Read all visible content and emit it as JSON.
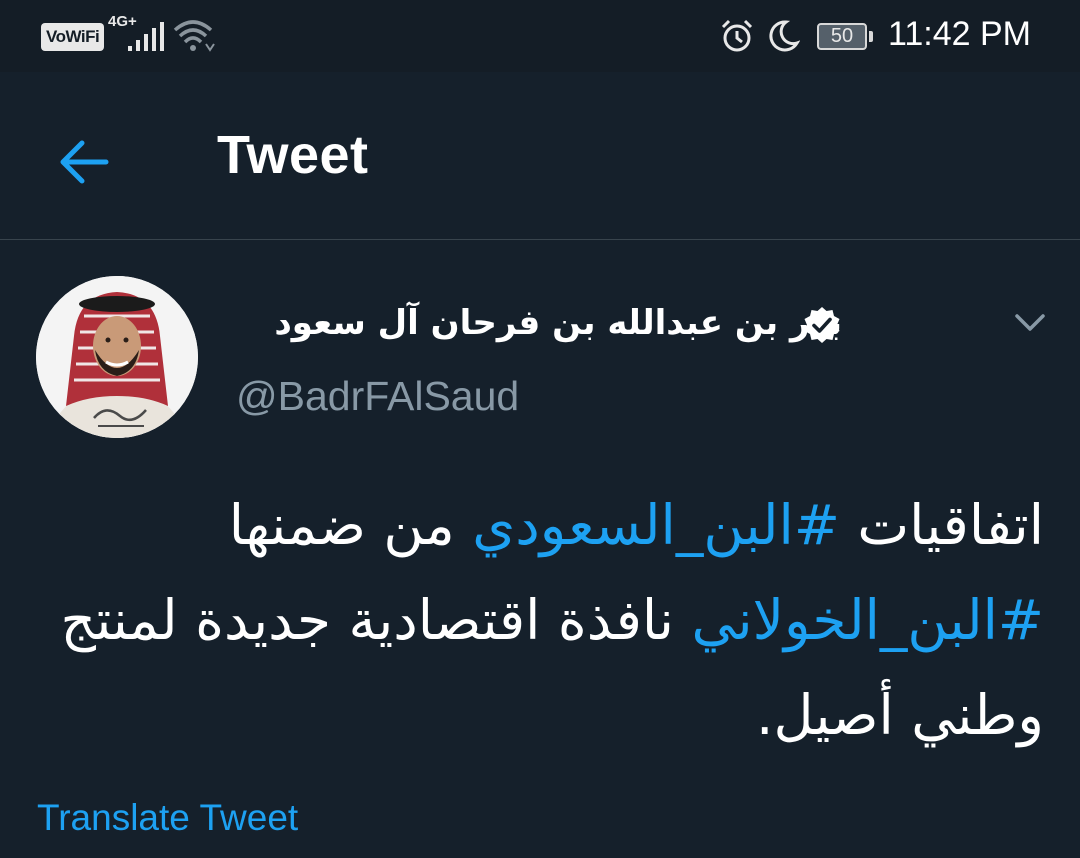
{
  "status_bar": {
    "vowifi": "VoWiFi",
    "network": "4G+",
    "battery": "50",
    "time": "11:42 PM",
    "icons": [
      "signal-icon",
      "wifi-icon",
      "alarm-icon",
      "moon-icon",
      "battery-icon"
    ]
  },
  "header": {
    "back_icon": "arrow-left-icon",
    "title": "Tweet"
  },
  "tweet": {
    "author_name": "بدر بن عبدالله بن فرحان آل سعود",
    "verified_icon": "verified-badge-icon",
    "handle": "@BadrFAlSaud",
    "menu_icon": "chevron-down-icon",
    "text": {
      "part1": "اتفاقيات ",
      "hashtag1": "#البن_السعودي",
      "part2": " من ضمنها ",
      "hashtag2": "#البن_الخولاني",
      "part3": " نافذة اقتصادية جديدة لمنتج وطني أصيل."
    },
    "translate_label": "Translate Tweet"
  },
  "colors": {
    "background": "#15202b",
    "accent": "#1da1f2",
    "secondary_text": "#8899a6",
    "divider": "#38444d"
  }
}
